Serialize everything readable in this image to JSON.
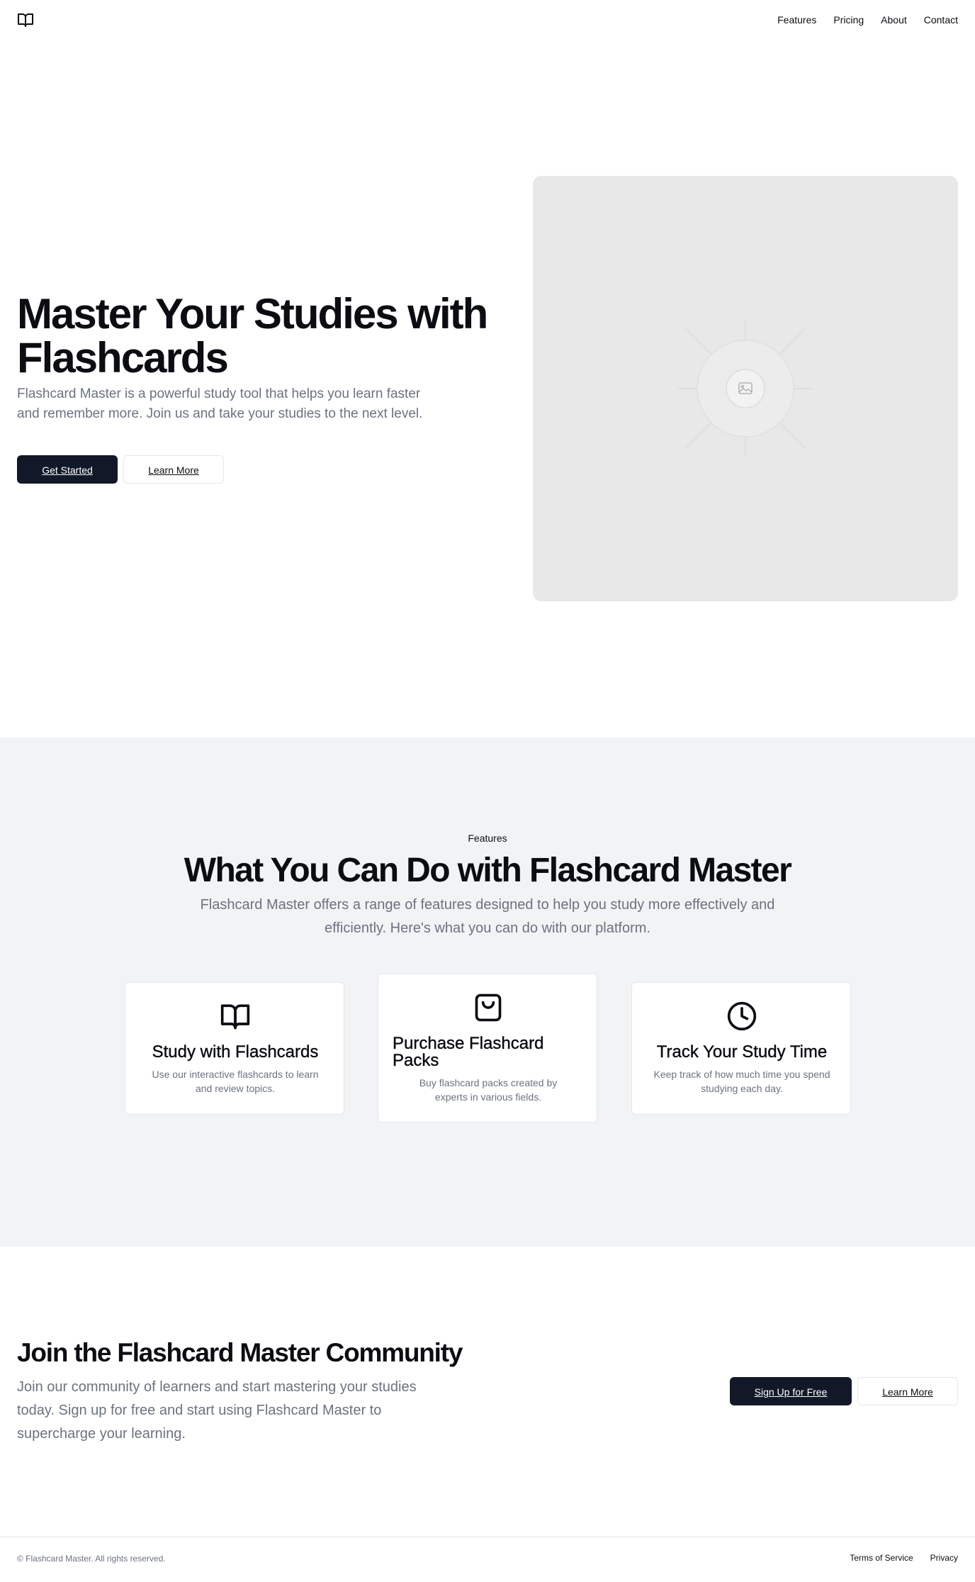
{
  "header": {
    "logo_icon": "book-open-icon",
    "nav": [
      {
        "label": "Features"
      },
      {
        "label": "Pricing"
      },
      {
        "label": "About"
      },
      {
        "label": "Contact"
      }
    ]
  },
  "hero": {
    "title": "Master Your Studies with Flashcards",
    "description": "Flashcard Master is a powerful study tool that helps you learn faster and remember more. Join us and take your studies to the next level.",
    "primary_button": "Get Started",
    "secondary_button": "Learn More",
    "image_icon": "image-placeholder-icon"
  },
  "features": {
    "label": "Features",
    "title": "What You Can Do with Flashcard Master",
    "description": "Flashcard Master offers a range of features designed to help you study more effectively and efficiently. Here's what you can do with our platform.",
    "cards": [
      {
        "icon": "book-open-icon",
        "title": "Study with Flashcards",
        "text": "Use our interactive flashcards to learn and review topics."
      },
      {
        "icon": "shopping-bag-icon",
        "title": "Purchase Flashcard Packs",
        "text": "Buy flashcard packs created by experts in various fields."
      },
      {
        "icon": "clock-icon",
        "title": "Track Your Study Time",
        "text": "Keep track of how much time you spend studying each day."
      }
    ]
  },
  "community": {
    "title": "Join the Flashcard Master Community",
    "description": "Join our community of learners and start mastering your studies today. Sign up for free and start using Flashcard Master to supercharge your learning.",
    "primary_button": "Sign Up for Free",
    "secondary_button": "Learn More"
  },
  "footer": {
    "copyright": "© Flashcard Master. All rights reserved.",
    "links": [
      {
        "label": "Terms of Service"
      },
      {
        "label": "Privacy"
      }
    ]
  },
  "colors": {
    "primary": "#111827",
    "muted_text": "#6b7280",
    "section_bg": "#f2f3f5",
    "placeholder_bg": "#e8e8e8"
  }
}
